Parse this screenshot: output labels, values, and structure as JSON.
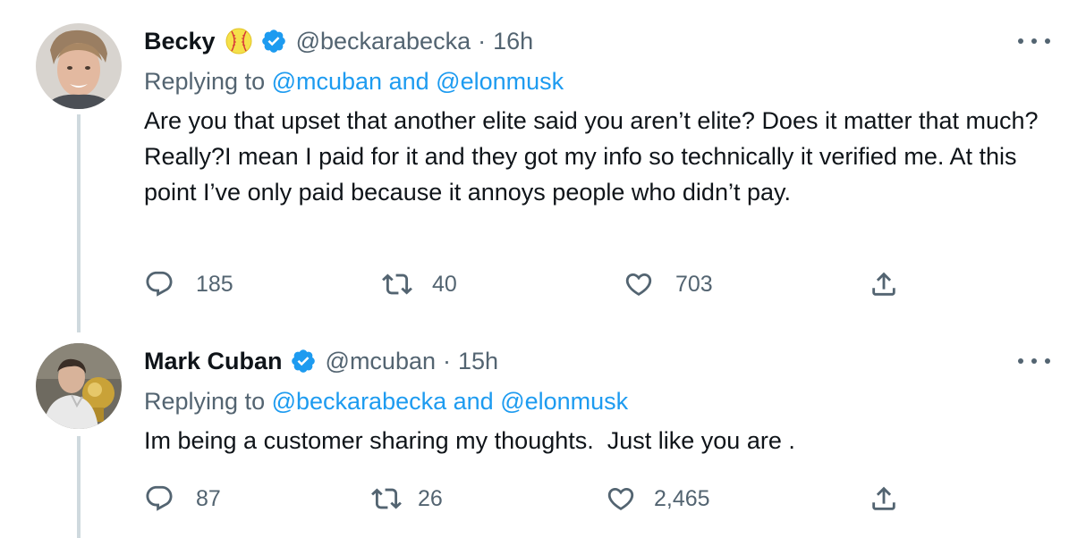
{
  "tweets": [
    {
      "display_name": "Becky",
      "emoji": "softball-emoji",
      "verified": true,
      "handle": "@beckarabecka",
      "separator": "·",
      "time": "16h",
      "replying_prefix": "Replying to",
      "replying_user_1": "@mcuban",
      "replying_and": "and",
      "replying_user_2": "@elonmusk",
      "text": "Are you that upset that another elite said you aren’t elite? Does it matter that much? Really?I mean I paid for it and they got my info so technically it verified me. At this point I’ve only paid because it annoys people who didn’t pay.",
      "replies": "185",
      "retweets": "40",
      "likes": "703"
    },
    {
      "display_name": "Mark Cuban",
      "verified": true,
      "handle": "@mcuban",
      "separator": "·",
      "time": "15h",
      "replying_prefix": "Replying to",
      "replying_user_1": "@beckarabecka",
      "replying_and": "and",
      "replying_user_2": "@elonmusk",
      "text": "Im being a customer sharing my thoughts.  Just like you are .",
      "replies": "87",
      "retweets": "26",
      "likes": "2,465"
    }
  ],
  "icons": {
    "reply": "reply-icon",
    "retweet": "retweet-icon",
    "like": "heart-icon",
    "share": "share-icon",
    "more": "more-icon",
    "verified": "verified-badge-icon"
  },
  "colors": {
    "link": "#1d9bf0",
    "secondary_text": "#536471",
    "verified": "#1d9bf0",
    "thread_line": "#cfd9de"
  }
}
